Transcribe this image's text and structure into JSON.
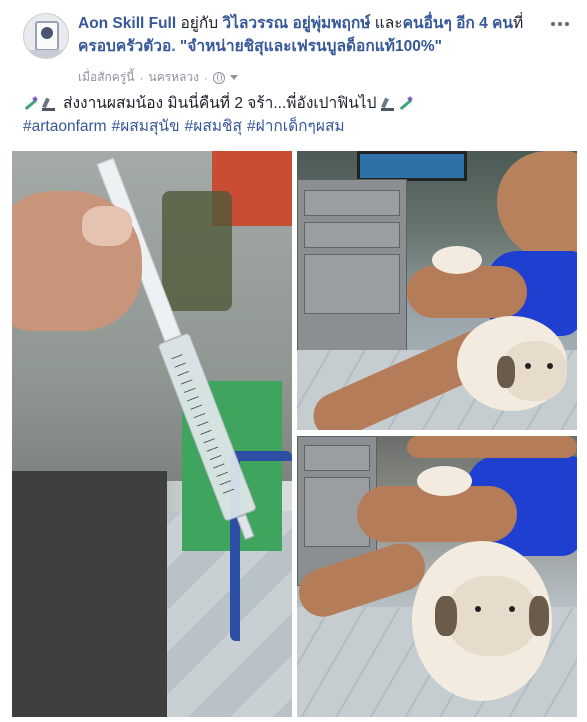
{
  "post": {
    "author": "Aon Skill Full",
    "with_text": " อยู่กับ ",
    "tagged1": "วิไลวรรณ อยู่พุ่มพฤกษ์",
    "and_text": " และ",
    "others": "คนอื่นๆ อีก 4 คน",
    "at_text": "ที่ ",
    "place": "ครอบครัวตัวอ. \"จำหน่ายชิสุและเฟรนบูลด็อกแท้100%\"",
    "time": "เมื่อสักครู่นี้",
    "separator": "·",
    "location": "นครหลวง",
    "privacy_separator": "·",
    "privacy_icon": "globe-icon",
    "more_icon": "more-options-icon"
  },
  "message": {
    "line1": "ส่งงานผสมน้อง มินนี่คืนที่ 2 จร้า...พี่อังเปาฟินไป",
    "hashtags": [
      "#artaonfarm",
      "#ผสมสุนัข",
      "#ผสมชิสุ",
      "#ฝากเด็กๆผสม"
    ],
    "emoji": [
      "syringe-icon",
      "microscope-icon"
    ]
  },
  "photos": [
    {
      "name": "syringe-photo"
    },
    {
      "name": "dog-photo-1"
    },
    {
      "name": "dog-photo-2"
    }
  ],
  "colors": {
    "link": "#365899",
    "text": "#1d2129",
    "meta": "#90949c"
  }
}
